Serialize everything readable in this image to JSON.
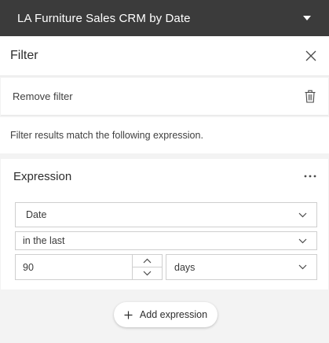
{
  "layer_header": {
    "title": "LA Furniture Sales CRM by Date",
    "dropdown_icon": "caret-down-icon"
  },
  "panel": {
    "title": "Filter",
    "close_icon": "close-icon"
  },
  "remove_filter": {
    "label": "Remove filter",
    "icon": "trash-icon"
  },
  "description": "Filter results match the following expression.",
  "expression": {
    "title": "Expression",
    "menu_icon": "more-horizontal-icon",
    "field": {
      "value": "Date"
    },
    "operator": {
      "value": "in the last"
    },
    "amount": {
      "value": "90"
    },
    "unit": {
      "value": "days"
    }
  },
  "add_expression": {
    "label": "Add expression",
    "icon": "plus-icon"
  },
  "colors": {
    "header_bg": "#3b3b3b",
    "panel_bg": "#ffffff",
    "page_bg": "#f3f3f3",
    "border": "#cfcfcf"
  }
}
